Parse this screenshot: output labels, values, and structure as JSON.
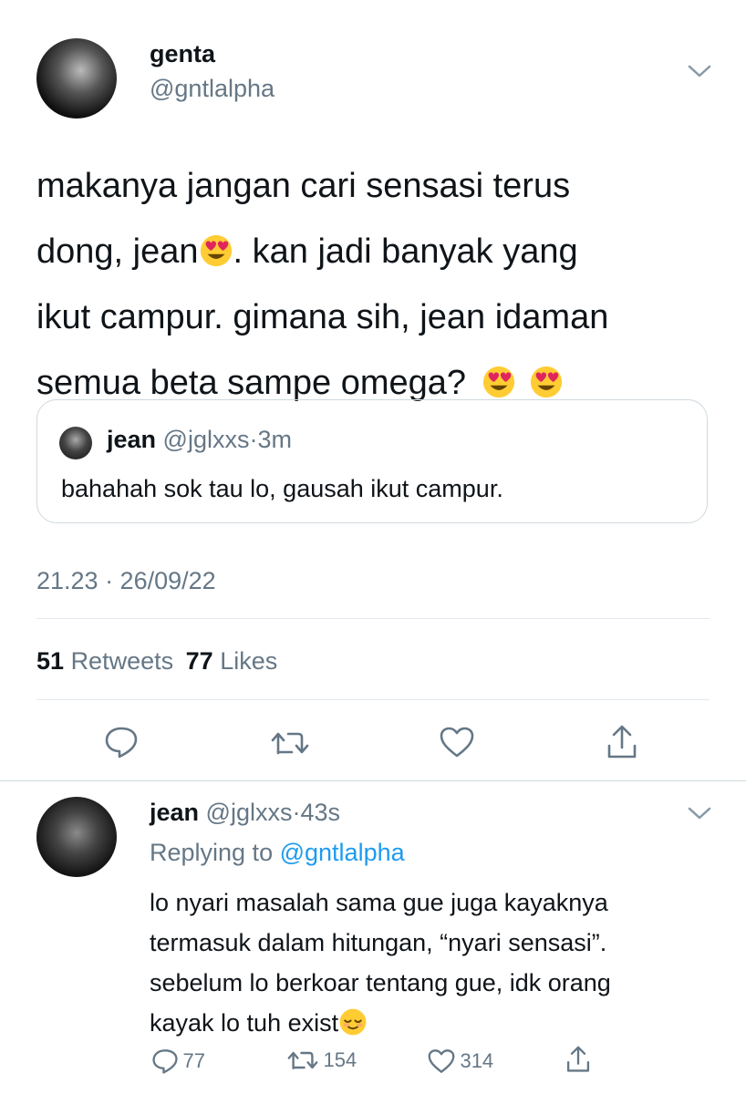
{
  "tweet": {
    "display_name": "genta",
    "handle": "@gntlalpha",
    "text_parts": [
      "makanya jangan cari sensasi terus",
      "dong, jean",
      ". kan jadi banyak yang",
      "ikut campur. gimana sih, jean idaman",
      "semua beta sampe omega?"
    ],
    "quote": {
      "display_name": "jean",
      "handle": "@jglxxs",
      "sep": "·",
      "time": "3m",
      "text": "bahahah sok tau lo, gausah ikut campur."
    },
    "timestamp": "21.23 · 26/09/22",
    "retweets_count": "51",
    "retweets_label": "Retweets",
    "likes_count": "77",
    "likes_label": "Likes"
  },
  "reply": {
    "display_name": "jean",
    "handle": "@jglxxs",
    "sep": "·",
    "time": "43s",
    "replying_prefix": "Replying to",
    "replying_handle": "@gntlalpha",
    "lines": [
      "lo nyari masalah sama gue juga kayaknya",
      "termasuk dalam hitungan, “nyari sensasi”.",
      "sebelum lo berkoar tentang gue, idk orang",
      "kayak lo tuh exist"
    ],
    "reply_count": "77",
    "retweet_count": "154",
    "like_count": "314"
  },
  "icons": {
    "chevron": "chevron-down-icon",
    "reply": "reply-icon",
    "retweet": "retweet-icon",
    "like": "heart-icon",
    "share": "share-icon",
    "heart_eyes": "heart-eyes-emoji",
    "relieved": "relieved-emoji"
  },
  "colors": {
    "text": "#0f1419",
    "muted": "#657786",
    "link": "#1d9bf0",
    "divider": "#e1e8ed"
  }
}
